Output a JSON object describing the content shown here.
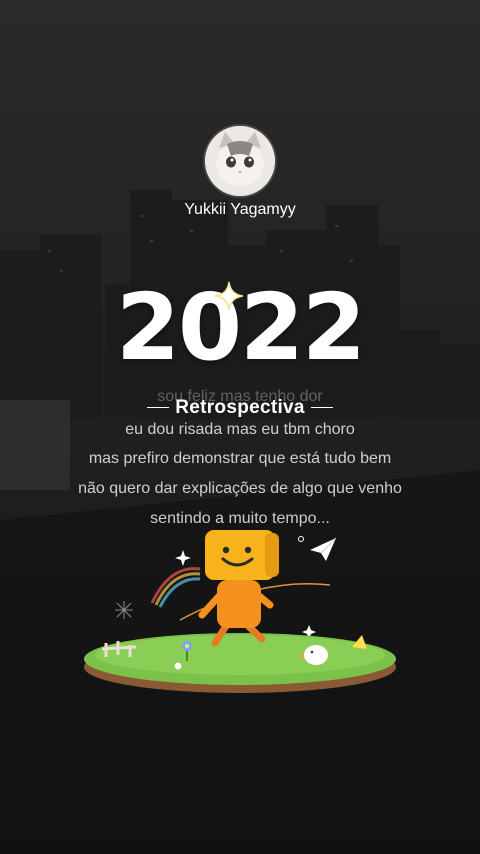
{
  "profile": {
    "username": "Yukkii Yagamyy"
  },
  "year": "2022",
  "subtitle": "Retrospectiva",
  "ghost_text": "sou feliz mas tenho dor",
  "lyrics": [
    "eu dou risada mas eu tbm choro",
    "mas prefiro demonstrar que está tudo bem",
    "não quero dar explicações de algo que venho",
    "sentindo a muito tempo..."
  ],
  "colors": {
    "background": "#1e1e1e",
    "text": "#ffffff",
    "mascot": "#f5a623",
    "grass": "#7bc24a"
  },
  "icons": [
    "sparkle-icon",
    "paper-plane-icon",
    "rainbow-icon",
    "flower-icon",
    "bird-icon"
  ]
}
